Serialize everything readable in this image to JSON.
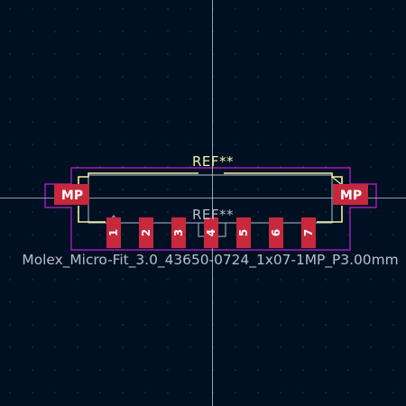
{
  "footprint": {
    "reference_silk": "REF**",
    "reference_fab": "REF**",
    "value": "Molex_Micro-Fit_3.0_43650-0724_1x07-1MP_P3.00mm"
  },
  "pads": [
    {
      "label": "1"
    },
    {
      "label": "2"
    },
    {
      "label": "3"
    },
    {
      "label": "4"
    },
    {
      "label": "5"
    },
    {
      "label": "6"
    },
    {
      "label": "7"
    }
  ],
  "mounting_pads": [
    {
      "label": "MP"
    },
    {
      "label": "MP"
    }
  ],
  "colors": {
    "background": "#001023",
    "grid": "#4a5a78",
    "crosshair": "#bfc8d8",
    "courtyard": "#c41fd6",
    "silkscreen": "#f2f2a0",
    "fab": "#b8bfc8",
    "pad": "#c8283c",
    "pad_text": "#ffffff"
  }
}
